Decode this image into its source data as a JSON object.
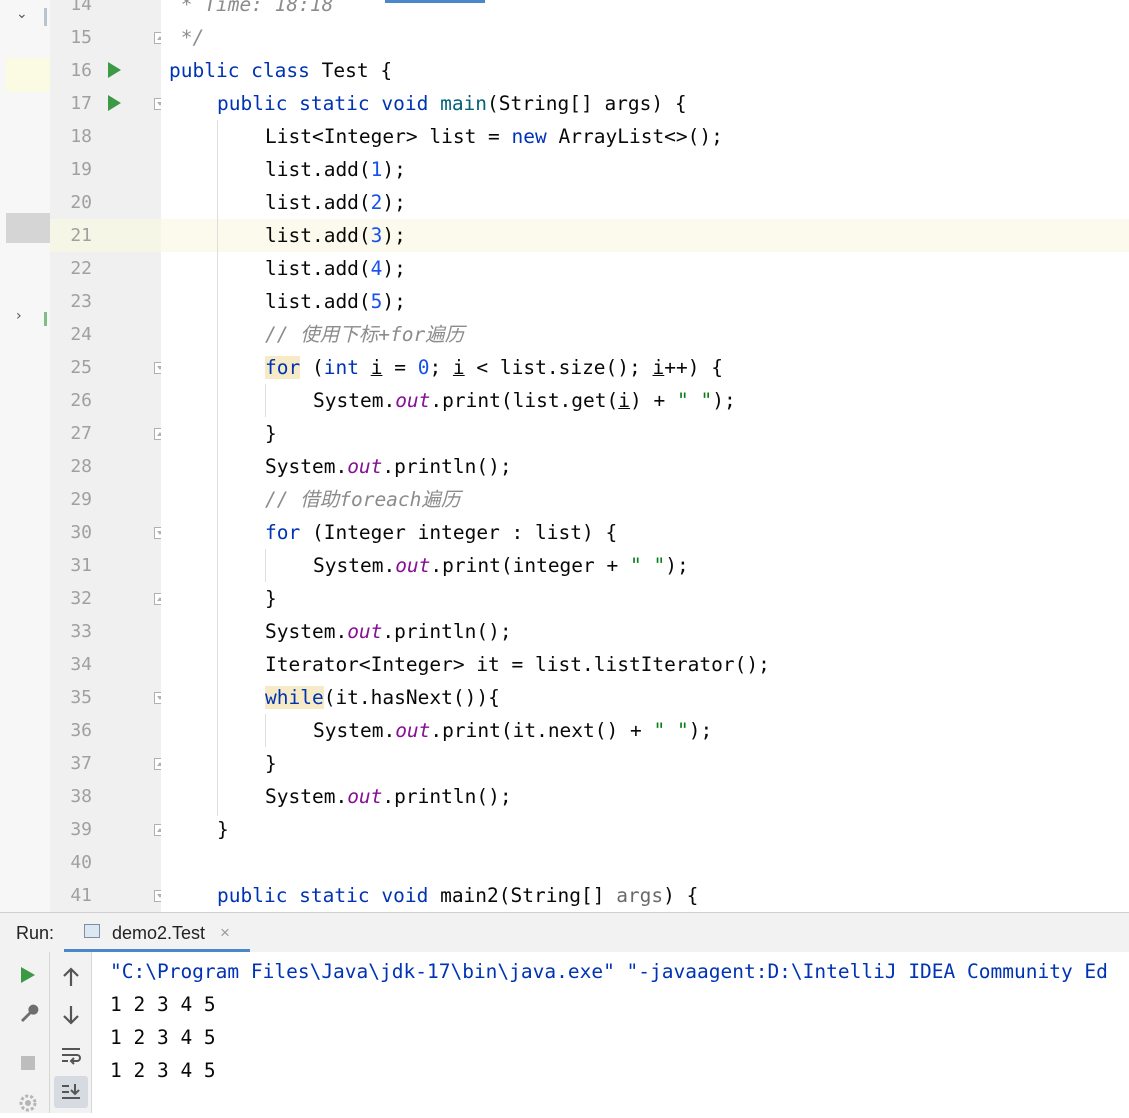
{
  "editor": {
    "lines": [
      {
        "num": "14"
      },
      {
        "num": "15"
      },
      {
        "num": "16"
      },
      {
        "num": "17"
      },
      {
        "num": "18"
      },
      {
        "num": "19"
      },
      {
        "num": "20"
      },
      {
        "num": "21"
      },
      {
        "num": "22"
      },
      {
        "num": "23"
      },
      {
        "num": "24"
      },
      {
        "num": "25"
      },
      {
        "num": "26"
      },
      {
        "num": "27"
      },
      {
        "num": "28"
      },
      {
        "num": "29"
      },
      {
        "num": "30"
      },
      {
        "num": "31"
      },
      {
        "num": "32"
      },
      {
        "num": "33"
      },
      {
        "num": "34"
      },
      {
        "num": "35"
      },
      {
        "num": "36"
      },
      {
        "num": "37"
      },
      {
        "num": "38"
      },
      {
        "num": "39"
      },
      {
        "num": "40"
      },
      {
        "num": "41"
      }
    ],
    "code": {
      "l14": " * Time: 18:18",
      "l15": " */",
      "l16_kw": "public class",
      "l16_name": " Test {",
      "l17_kw": "public static void",
      "l17_fn": "main",
      "l17_rest": "(String[] args) {",
      "l18_a": "List<Integer> list = ",
      "l18_kw": "new",
      "l18_b": " ArrayList<>();",
      "add_prefix": "list.add(",
      "add_suffix": ");",
      "l19_n": "1",
      "l20_n": "2",
      "l21_n": "3",
      "l22_n": "4",
      "l23_n": "5",
      "l24_cmt": "// 使用下标+for遍历",
      "kw_for": "for",
      "l25_a": " (",
      "kw_int": "int",
      "var_i": "i",
      "l25_b": " = ",
      "l25_zero": "0",
      "l25_c": "; ",
      "l25_d": " < list.size(); ",
      "l25_e": "++) {",
      "sys": "System.",
      "out": "out",
      "l26_a": ".print(list.get(",
      "l26_b": ") + ",
      "space_str": "\" \"",
      "close_paren": ");",
      "brace_close": "}",
      "println": ".println();",
      "l29_cmt": "// 借助foreach遍历",
      "l30_rest": " (Integer integer : list) {",
      "l31_a": ".print(integer + ",
      "l34": "Iterator<Integer> it = list.listIterator();",
      "kw_while": "while",
      "l35_rest": "(it.hasNext()){",
      "l36_a": ".print(it.next() + ",
      "l39": "}",
      "l41_kw": "public static void",
      "l41_fn": "main2",
      "l41_a": "(String[] ",
      "l41_par": "args",
      "l41_b": ") {"
    }
  },
  "run": {
    "label": "Run:",
    "tab": "demo2.Test",
    "tab_close": "×",
    "console": {
      "cmd": "\"C:\\Program Files\\Java\\jdk-17\\bin\\java.exe\" \"-javaagent:D:\\IntelliJ IDEA Community Ed",
      "out1": "1 2 3 4 5",
      "out2": "1 2 3 4 5",
      "out3": "1 2 3 4 5"
    }
  },
  "icons": [
    "run-icon",
    "fold-icon",
    "rerun-icon",
    "wrench-icon",
    "stop-icon",
    "settings-icon",
    "up-arrow-icon",
    "down-arrow-icon",
    "soft-wrap-icon",
    "scroll-to-end-icon",
    "close-icon",
    "chevron-down-icon",
    "chevron-right-icon"
  ],
  "colors": {
    "keyword": "#0033b3",
    "number": "#1750eb",
    "string": "#067d17",
    "static_field": "#871094",
    "comment": "#8c8c8c",
    "method_decl": "#00627a",
    "run_green": "#3c9a46"
  }
}
